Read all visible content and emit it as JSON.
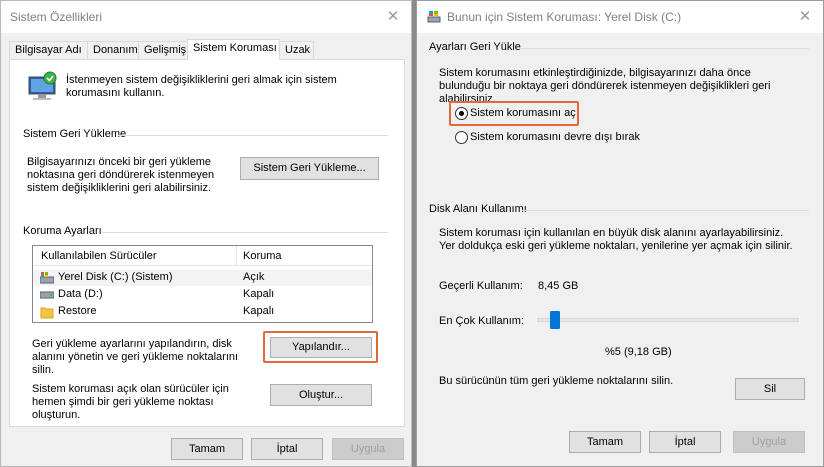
{
  "win1": {
    "title": "Sistem Özellikleri",
    "close": "✕",
    "tabs": [
      "Bilgisayar Adı",
      "Donanım",
      "Gelişmiş",
      "Sistem Koruması",
      "Uzak"
    ],
    "intro": "İstenmeyen sistem değişikliklerini geri almak için sistem korumasını kullanın.",
    "restore": {
      "heading": "Sistem Geri Yükleme",
      "desc": "Bilgisayarınızı önceki bir geri yükleme noktasına geri döndürerek istenmeyen sistem değişikliklerini geri alabilirsiniz.",
      "button": "Sistem Geri Yükleme..."
    },
    "protection": {
      "heading": "Koruma Ayarları",
      "columns": [
        "Kullanılabilen Sürücüler",
        "Koruma"
      ],
      "rows": [
        {
          "drive": "Yerel Disk (C:) (Sistem)",
          "status": "Açık",
          "icon": "system-drive-icon"
        },
        {
          "drive": "Data (D:)",
          "status": "Kapalı",
          "icon": "drive-icon"
        },
        {
          "drive": "Restore",
          "status": "Kapalı",
          "icon": "folder-icon"
        }
      ],
      "configure_desc": "Geri yükleme ayarlarını yapılandırın, disk alanını yönetin ve geri yükleme noktalarını silin.",
      "configure_button": "Yapılandır...",
      "create_desc": "Sistem koruması açık olan sürücüler için hemen şimdi bir geri yükleme noktası oluşturun.",
      "create_button": "Oluştur..."
    },
    "buttons": {
      "ok": "Tamam",
      "cancel": "İptal",
      "apply": "Uygula"
    }
  },
  "win2": {
    "title": "Bunun için Sistem Koruması: Yerel Disk (C:)",
    "close": "✕",
    "restore_settings": {
      "heading": "Ayarları Geri Yükle",
      "desc": "Sistem korumasını etkinleştirdiğinizde, bilgisayarınızı daha önce bulunduğu bir noktaya geri döndürerek istenmeyen değişiklikleri geri alabilirsiniz.",
      "option_on": "Sistem korumasını aç",
      "option_off": "Sistem korumasını devre dışı bırak",
      "selected": "Sistem korumasını aç"
    },
    "disk_usage": {
      "heading": "Disk Alanı Kullanımı",
      "desc": "Sistem koruması için kullanılan en büyük disk alanını ayarlayabilirsiniz. Yer doldukça eski geri yükleme noktaları, yenilerine yer açmak için silinir.",
      "current_label": "Geçerli Kullanım:",
      "current_value": "8,45 GB",
      "max_label": "En Çok Kullanım:",
      "slider_percent": 5,
      "max_value": "%5 (9,18 GB)",
      "delete_desc": "Bu sürücünün tüm geri yükleme noktalarını silin.",
      "delete_button": "Sil"
    },
    "buttons": {
      "ok": "Tamam",
      "cancel": "İptal",
      "apply": "Uygula"
    }
  },
  "colors": {
    "highlight": "#e06a3a",
    "slider_thumb": "#0078d7",
    "selection": "#f3f3f3"
  }
}
